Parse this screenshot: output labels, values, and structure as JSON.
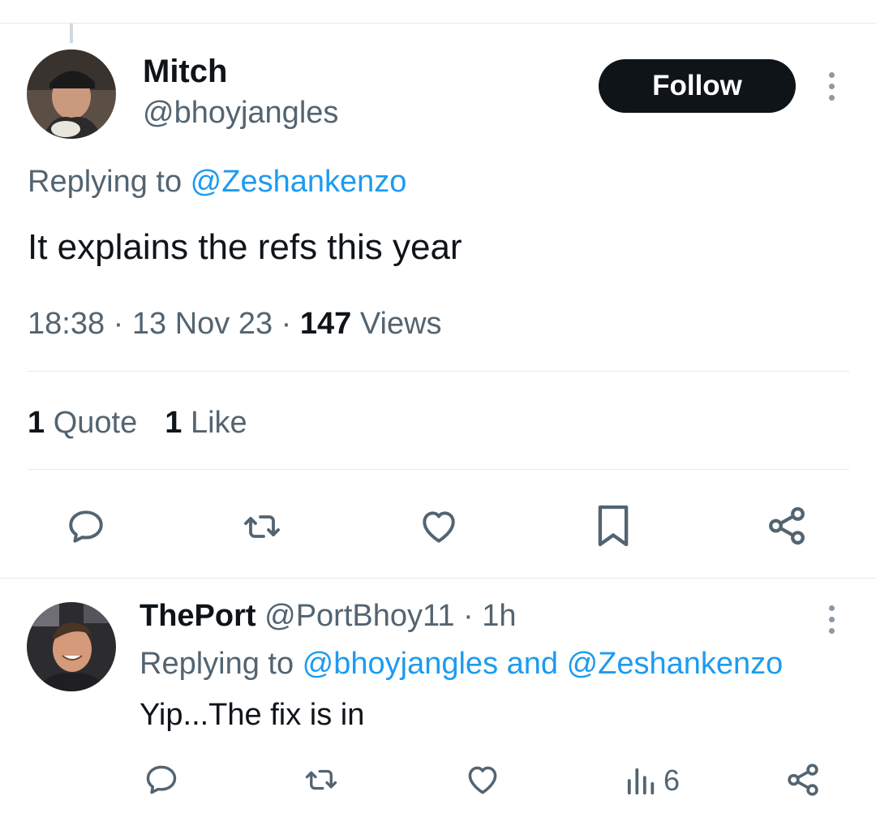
{
  "main_tweet": {
    "author_name": "Mitch",
    "author_handle": "@bhoyjangles",
    "follow_label": "Follow",
    "replying_prefix": "Replying to ",
    "replying_to": "@Zeshankenzo",
    "text": "It explains the refs this year",
    "time": "18:38",
    "date": "13 Nov 23",
    "views_count": "147",
    "views_label": "Views",
    "quotes_count": "1",
    "quotes_label": "Quote",
    "likes_count": "1",
    "likes_label": "Like",
    "actions": [
      "reply-icon",
      "retweet-icon",
      "like-icon",
      "bookmark-icon",
      "share-icon"
    ]
  },
  "reply_tweet": {
    "author_name": "ThePort",
    "author_handle": "@PortBhoy11",
    "time_ago": "1h",
    "replying_prefix": "Replying to ",
    "replying_to": "@bhoyjangles and @Zeshankenzo",
    "text": "Yip...The fix is in",
    "views_count": "6",
    "actions": [
      "reply-icon",
      "retweet-icon",
      "like-icon",
      "views-icon",
      "share-icon"
    ]
  },
  "colors": {
    "text_primary": "#0f1419",
    "text_secondary": "#536471",
    "link": "#1d9bf0",
    "border": "#e6e9eb",
    "button_bg": "#0f1419"
  }
}
